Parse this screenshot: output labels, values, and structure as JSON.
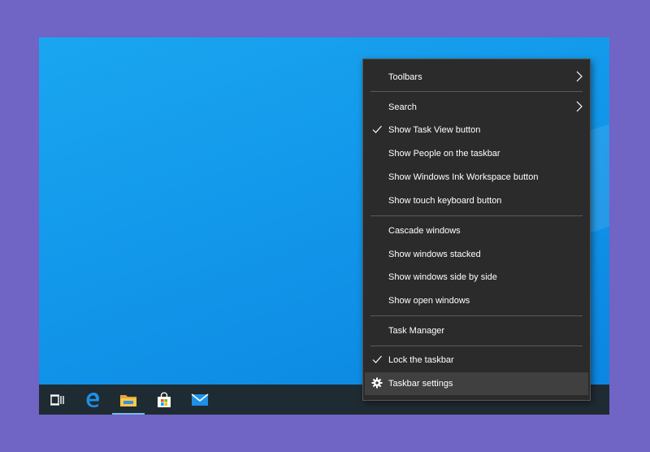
{
  "menu": {
    "items": [
      {
        "label": "Toolbars"
      },
      {
        "label": "Search"
      },
      {
        "label": "Show Task View button"
      },
      {
        "label": "Show People on the taskbar"
      },
      {
        "label": "Show Windows Ink Workspace button"
      },
      {
        "label": "Show touch keyboard button"
      },
      {
        "label": "Cascade windows"
      },
      {
        "label": "Show windows stacked"
      },
      {
        "label": "Show windows side by side"
      },
      {
        "label": "Show open windows"
      },
      {
        "label": "Task Manager"
      },
      {
        "label": "Lock the taskbar"
      },
      {
        "label": "Taskbar settings"
      }
    ]
  },
  "taskbar": {
    "icons": [
      "task-view-icon",
      "edge-icon",
      "file-explorer-icon",
      "store-icon",
      "mail-icon"
    ]
  },
  "colors": {
    "frame": "#7064c4",
    "desktop": "#1297ea",
    "taskbar": "#1f2b33",
    "menu_bg": "#2b2b2b",
    "menu_hover": "#404040",
    "separator": "#5a5a5a"
  }
}
